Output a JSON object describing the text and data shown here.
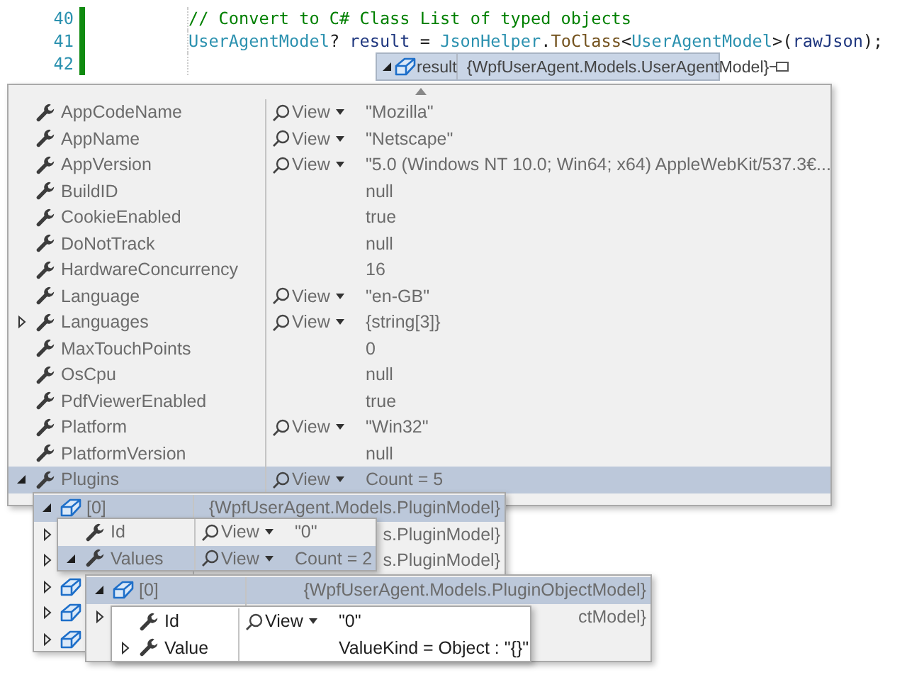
{
  "editor": {
    "lines": [
      {
        "number": "40",
        "tokens": [
          {
            "text": "// Convert to C# Class List of typed objects",
            "kind": "comment"
          }
        ]
      },
      {
        "number": "41",
        "tokens": [
          {
            "text": "UserAgentModel",
            "kind": "type"
          },
          {
            "text": "? ",
            "kind": "plain"
          },
          {
            "text": "result",
            "kind": "variable"
          },
          {
            "text": " = ",
            "kind": "plain"
          },
          {
            "text": "JsonHelper",
            "kind": "type"
          },
          {
            "text": ".",
            "kind": "plain"
          },
          {
            "text": "ToClass",
            "kind": "method"
          },
          {
            "text": "<",
            "kind": "plain"
          },
          {
            "text": "UserAgentModel",
            "kind": "type"
          },
          {
            "text": ">(",
            "kind": "plain"
          },
          {
            "text": "rawJson",
            "kind": "variable"
          },
          {
            "text": ");",
            "kind": "plain"
          }
        ]
      },
      {
        "number": "42"
      }
    ]
  },
  "datatip": {
    "name": "result",
    "value": "{WpfUserAgent.Models.UserAgentModel}",
    "kind": "object",
    "expanded": true
  },
  "popups": [
    {
      "active": false,
      "rows": [
        {
          "name": "AppCodeName",
          "kind": "property",
          "view": "View",
          "value": "\"Mozilla\"",
          "expandable": false
        },
        {
          "name": "AppName",
          "kind": "property",
          "view": "View",
          "value": "\"Netscape\"",
          "expandable": false
        },
        {
          "name": "AppVersion",
          "kind": "property",
          "view": "View",
          "value": "\"5.0 (Windows NT 10.0; Win64; x64) AppleWebKit/537.3€...",
          "expandable": false
        },
        {
          "name": "BuildID",
          "kind": "property",
          "value": "null",
          "expandable": false
        },
        {
          "name": "CookieEnabled",
          "kind": "property",
          "value": "true",
          "expandable": false
        },
        {
          "name": "DoNotTrack",
          "kind": "property",
          "value": "null",
          "expandable": false
        },
        {
          "name": "HardwareConcurrency",
          "kind": "property",
          "value": "16",
          "expandable": false
        },
        {
          "name": "Language",
          "kind": "property",
          "view": "View",
          "value": "\"en-GB\"",
          "expandable": false
        },
        {
          "name": "Languages",
          "kind": "property",
          "view": "View",
          "value": "{string[3]}",
          "expandable": true,
          "expanded": false
        },
        {
          "name": "MaxTouchPoints",
          "kind": "property",
          "value": "0",
          "expandable": false
        },
        {
          "name": "OsCpu",
          "kind": "property",
          "value": "null",
          "expandable": false
        },
        {
          "name": "PdfViewerEnabled",
          "kind": "property",
          "value": "true",
          "expandable": false
        },
        {
          "name": "Platform",
          "kind": "property",
          "view": "View",
          "value": "\"Win32\"",
          "expandable": false
        },
        {
          "name": "PlatformVersion",
          "kind": "property",
          "value": "null",
          "expandable": false
        },
        {
          "name": "Plugins",
          "kind": "property",
          "view": "View",
          "value": "Count = 5",
          "expandable": true,
          "expanded": true
        }
      ]
    },
    {
      "active": false,
      "rows": [
        {
          "name": "[0]",
          "kind": "object",
          "value": "{WpfUserAgent.Models.PluginModel}",
          "expandable": true,
          "expanded": true
        },
        {
          "kind": "object",
          "value": "s.PluginModel}",
          "expandable": true,
          "expanded": false
        },
        {
          "kind": "object",
          "value": "s.PluginModel}",
          "expandable": true,
          "expanded": false
        },
        {
          "kind": "object",
          "expandable": true,
          "expanded": false
        },
        {
          "kind": "object",
          "expandable": true,
          "expanded": false
        },
        {
          "kind": "object",
          "expandable": true,
          "expanded": false
        }
      ]
    },
    {
      "active": false,
      "rows": [
        {
          "name": "Id",
          "kind": "property",
          "view": "View",
          "value": "\"0\"",
          "expandable": false
        },
        {
          "name": "Values",
          "kind": "property",
          "view": "View",
          "value": "Count = 2",
          "expandable": true,
          "expanded": true
        }
      ]
    },
    {
      "active": false,
      "rows": [
        {
          "name": "[0]",
          "kind": "object",
          "value": "{WpfUserAgent.Models.PluginObjectModel}",
          "expandable": true,
          "expanded": true
        },
        {
          "kind": "object",
          "value": "ctModel}",
          "expandable": true,
          "expanded": false
        }
      ]
    },
    {
      "active": true,
      "rows": [
        {
          "name": "Id",
          "kind": "property",
          "view": "View",
          "value": "\"0\"",
          "expandable": false
        },
        {
          "name": "Value",
          "kind": "property",
          "value": "ValueKind = Object : \"{}\"",
          "expandable": true,
          "expanded": false
        }
      ]
    }
  ]
}
